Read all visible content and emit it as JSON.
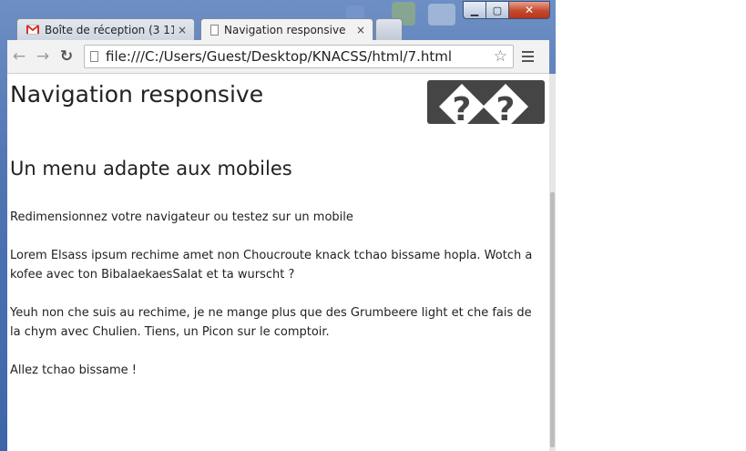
{
  "browser": {
    "tabs": [
      {
        "label": "Boîte de réception (3 11",
        "icon": "gmail-icon",
        "close": "×"
      },
      {
        "label": "Navigation responsive",
        "icon": "document-icon",
        "close": "×"
      }
    ],
    "url": "file:///C:/Users/Guest/Desktop/KNACSS/html/7.html",
    "controls": {
      "back": "←",
      "forward": "→",
      "reload": "↻",
      "star": "☆"
    },
    "caption": {
      "minimize": "▁",
      "maximize": "▢",
      "close": "✕"
    }
  },
  "page": {
    "title": "Navigation responsive",
    "subtitle": "Un menu adapte aux mobiles",
    "paragraphs": [
      "Redimensionnez votre navigateur ou testez sur un mobile",
      "Lorem Elsass ipsum rechime amet non Choucroute knack tchao bissame hopla. Wotch a kofee avec ton BibalaekaesSalat et ta wurscht ?",
      "Yeuh non che suis au rechime, je ne mange plus que des Grumbeere light et che fais de la chym avec Chulien. Tiens, un Picon sur le comptoir.",
      "Allez tchao bissame !"
    ],
    "logo": {
      "icon": "missing-image-icon",
      "glyph": "?"
    }
  },
  "colors": {
    "frame": "#4f74b3",
    "close_button": "#c44a2d",
    "logo_bg": "#454545",
    "text": "#222222"
  }
}
